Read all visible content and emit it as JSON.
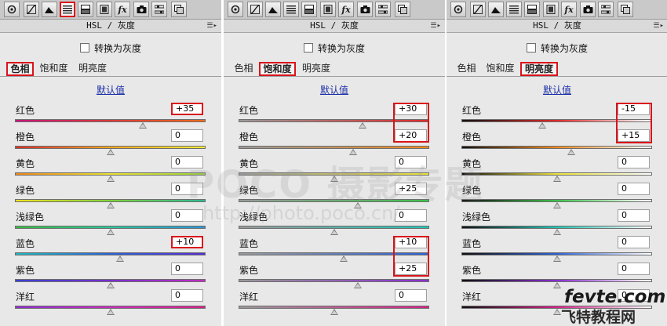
{
  "colors": {
    "highlight": "#d9141b",
    "link": "#1b2fa8",
    "panel": "#e8e8e8"
  },
  "toolbar_icons": [
    "camera-icon",
    "curve-icon",
    "mountain-icon",
    "hsl-icon",
    "split-tone-icon",
    "lens-icon",
    "fx-icon",
    "camera-calibration-icon",
    "presets-icon",
    "snapshots-icon"
  ],
  "panels": [
    {
      "header": "HSL / 灰度",
      "gray_label": "转换为灰度",
      "tabs": [
        "色相",
        "饱和度",
        "明亮度"
      ],
      "active_tab": 0,
      "default_link": "默认值",
      "sliders": [
        {
          "label": "红色",
          "value": "+35",
          "level": 0.67
        },
        {
          "label": "橙色",
          "value": "0",
          "level": 0.5
        },
        {
          "label": "黄色",
          "value": "0",
          "level": 0.5
        },
        {
          "label": "绿色",
          "value": "0",
          "level": 0.5
        },
        {
          "label": "浅绿色",
          "value": "0",
          "level": 0.5
        },
        {
          "label": "蓝色",
          "value": "+10",
          "level": 0.55
        },
        {
          "label": "紫色",
          "value": "0",
          "level": 0.5
        },
        {
          "label": "洋红",
          "value": "0",
          "level": 0.5
        }
      ]
    },
    {
      "header": "HSL / 灰度",
      "gray_label": "转换为灰度",
      "tabs": [
        "色相",
        "饱和度",
        "明亮度"
      ],
      "active_tab": 1,
      "default_link": "默认值",
      "sliders": [
        {
          "label": "红色",
          "value": "+30",
          "level": 0.65
        },
        {
          "label": "橙色",
          "value": "+20",
          "level": 0.6
        },
        {
          "label": "黄色",
          "value": "0",
          "level": 0.5
        },
        {
          "label": "绿色",
          "value": "+25",
          "level": 0.625
        },
        {
          "label": "浅绿色",
          "value": "0",
          "level": 0.5
        },
        {
          "label": "蓝色",
          "value": "+10",
          "level": 0.55
        },
        {
          "label": "紫色",
          "value": "+25",
          "level": 0.625
        },
        {
          "label": "洋红",
          "value": "0",
          "level": 0.5
        }
      ]
    },
    {
      "header": "HSL / 灰度",
      "gray_label": "转换为灰度",
      "tabs": [
        "色相",
        "饱和度",
        "明亮度"
      ],
      "active_tab": 2,
      "default_link": "默认值",
      "sliders": [
        {
          "label": "红色",
          "value": "-15",
          "level": 0.425
        },
        {
          "label": "橙色",
          "value": "+15",
          "level": 0.575
        },
        {
          "label": "黄色",
          "value": "0",
          "level": 0.5
        },
        {
          "label": "绿色",
          "value": "0",
          "level": 0.5
        },
        {
          "label": "浅绿色",
          "value": "0",
          "level": 0.5
        },
        {
          "label": "蓝色",
          "value": "0",
          "level": 0.5
        },
        {
          "label": "紫色",
          "value": "0",
          "level": 0.5
        },
        {
          "label": "洋红",
          "value": "0",
          "level": 0.5
        }
      ]
    }
  ],
  "watermark": {
    "main": "POCO 摄影专题",
    "url": "http://photo.poco.cn/"
  },
  "brand": {
    "site": "fevte.com",
    "name": "飞特教程网"
  }
}
